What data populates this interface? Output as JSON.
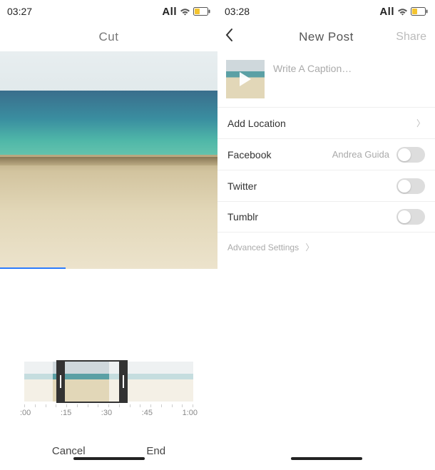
{
  "left": {
    "status": {
      "time": "03:27",
      "carrier": "All"
    },
    "nav": {
      "title": "Cut"
    },
    "timeline": {
      "ticks": [
        ":00",
        ":15",
        ":30",
        ":45",
        "1:00"
      ]
    },
    "actions": {
      "cancel": "Cancel",
      "end": "End"
    }
  },
  "right": {
    "status": {
      "time": "03:28",
      "carrier": "All"
    },
    "nav": {
      "title": "New Post",
      "share": "Share"
    },
    "caption": {
      "placeholder": "Write A Caption…"
    },
    "rows": {
      "location": "Add Location",
      "facebook": {
        "label": "Facebook",
        "value": "Andrea Guida"
      },
      "twitter": "Twitter",
      "tumblr": "Tumblr",
      "advanced": "Advanced Settings"
    }
  }
}
